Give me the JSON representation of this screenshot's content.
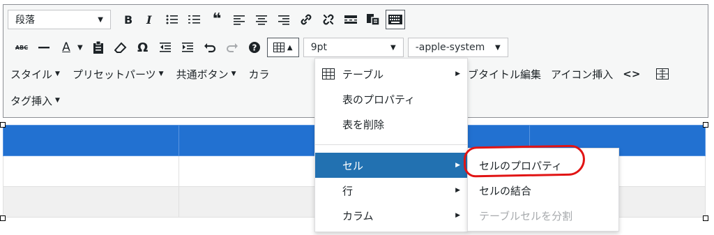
{
  "toolbar": {
    "format_select": "段落",
    "font_size": "9pt",
    "font_family": "-apple-system",
    "strikethrough_label": "ABC",
    "text_color_label": "A",
    "table_caret": "▲",
    "menus": [
      "スタイル",
      "プリセットパーツ",
      "共通ボタン",
      "カラ"
    ],
    "right_items": [
      "ブタイトル編集",
      "アイコン挿入",
      "<>"
    ],
    "tag_insert": "タグ挿入"
  },
  "table_menu": {
    "items": [
      {
        "label": "テーブル",
        "submenu": true
      },
      {
        "label": "表のプロパティ",
        "submenu": false
      },
      {
        "label": "表を削除",
        "submenu": false
      },
      {
        "label": "セル",
        "submenu": true,
        "selected": true
      },
      {
        "label": "行",
        "submenu": true
      },
      {
        "label": "カラム",
        "submenu": true
      }
    ]
  },
  "cell_submenu": {
    "items": [
      {
        "label": "セルのプロパティ",
        "disabled": false,
        "highlighted_by_annotation": true
      },
      {
        "label": "セルの結合",
        "disabled": false
      },
      {
        "label": "テーブルセルを分割",
        "disabled": true
      }
    ]
  },
  "colors": {
    "header_row": "#2271d1",
    "selected_menu_item": "#2271b1",
    "annotation": "#e11414"
  }
}
